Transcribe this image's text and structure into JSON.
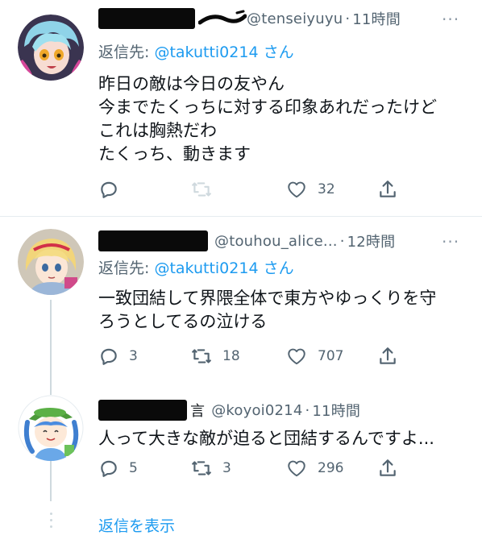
{
  "tweets": [
    {
      "handle": "@tenseiyuyu",
      "time": "11時間",
      "reply_label": "返信先: ",
      "reply_handle": "@takutti0214",
      "reply_suffix": " さん",
      "lines": [
        "昨日の敵は今日の友やん",
        "今までたくっちに対する印象あれだったけど",
        "これは胸熱だわ",
        "たくっち、動きます"
      ],
      "reply_count": "",
      "retweet_count": "",
      "like_count": "32"
    },
    {
      "handle": "@touhou_alice...",
      "time": "12時間",
      "reply_label": "返信先: ",
      "reply_handle": "@takutti0214",
      "reply_suffix": " さん",
      "lines": [
        "一致団結して界隈全体で東方やゆっくりを守",
        "ろうとしてるの泣ける"
      ],
      "reply_count": "3",
      "retweet_count": "18",
      "like_count": "707"
    },
    {
      "name_fragment": "言",
      "handle": "@koyoi0214",
      "time": "11時間",
      "lines": [
        "人って大きな敵が迫ると団結するんですよ..."
      ],
      "reply_count": "5",
      "retweet_count": "3",
      "like_count": "296"
    }
  ],
  "separator": "·",
  "more_label": "···",
  "show_replies_label": "返信を表示",
  "colors": {
    "link": "#1d9bf0",
    "muted": "#536471",
    "text": "#0f1419"
  }
}
